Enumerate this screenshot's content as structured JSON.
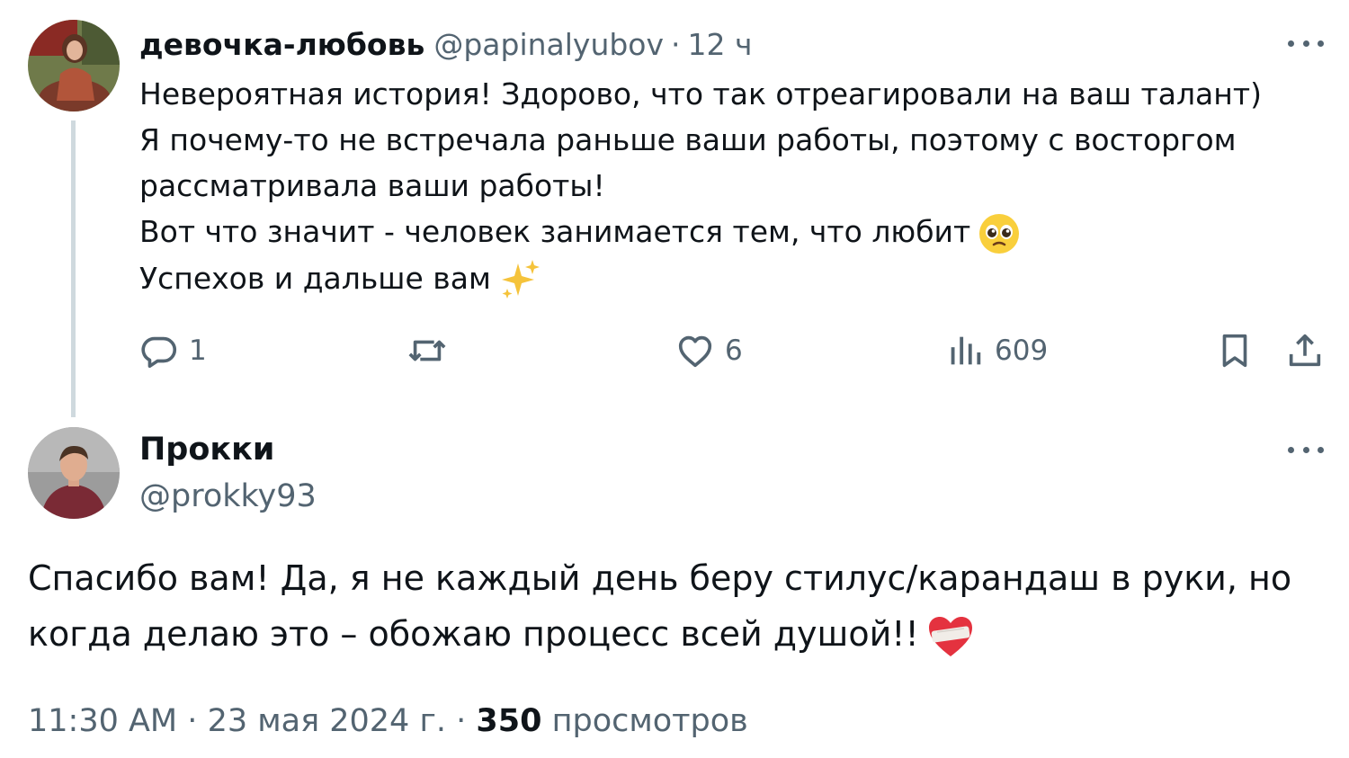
{
  "reply_tweet": {
    "author": {
      "display_name": "девочка-любовь",
      "handle": "@papinalyubov",
      "time": "12 ч",
      "separator": "·"
    },
    "lines": [
      "Невероятная история! Здорово, что так отреагировали на ваш талант)",
      "Я почему-то не встречала раньше ваши работы, поэтому с восторгом",
      "рассматривала ваши работы!",
      "Вот что значит - человек занимается тем, что любит",
      "Успехов и дальше вам"
    ],
    "emojis": [
      "pleading-face-emoji",
      "sparkles-emoji"
    ],
    "actions": {
      "reply_count": "1",
      "retweet_count": "",
      "like_count": "6",
      "view_count": "609"
    }
  },
  "main_tweet": {
    "author": {
      "display_name": "Прокки",
      "handle": "@prokky93"
    },
    "lines": [
      "Спасибо вам! Да, я не каждый день беру стилус/карандаш в руки, но",
      "когда делаю это – обожаю процесс всей душой!!"
    ],
    "emoji": "mending-heart-emoji",
    "meta": {
      "time": "11:30 AM",
      "separator": "·",
      "date": "23 мая 2024 г.",
      "views_count": "350",
      "views_label": "просмотров"
    }
  },
  "icons": [
    "more-icon",
    "reply-icon",
    "retweet-icon",
    "like-icon",
    "views-icon",
    "bookmark-icon",
    "share-icon"
  ],
  "colors": {
    "text": "#0f1419",
    "muted": "#536471",
    "thread_line": "#cfd9de",
    "background": "#ffffff"
  }
}
